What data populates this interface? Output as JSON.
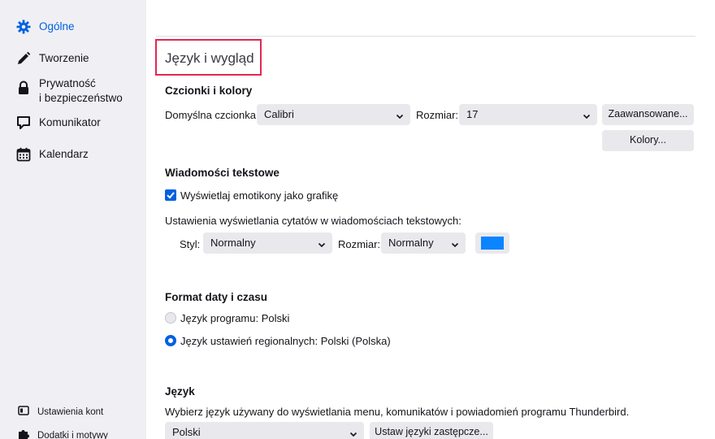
{
  "sidebar": {
    "items": [
      {
        "label": "Ogólne",
        "icon": "gear-icon"
      },
      {
        "label": "Tworzenie",
        "icon": "pencil-icon"
      },
      {
        "label": "Prywatność",
        "label2": "i bezpieczeństwo",
        "icon": "lock-icon"
      },
      {
        "label": "Komunikator",
        "icon": "chat-icon"
      },
      {
        "label": "Kalendarz",
        "icon": "calendar-icon"
      }
    ],
    "bottom": [
      {
        "label": "Ustawienia kont",
        "icon": "account-icon"
      },
      {
        "label": "Dodatki i motywy",
        "icon": "puzzle-icon"
      }
    ],
    "accent": "#0061e0"
  },
  "main": {
    "title": "Język i wygląd",
    "fonts": {
      "heading": "Czcionki i kolory",
      "default_font_label": "Domyślna czcionka:",
      "default_font_value": "Calibri",
      "size_label": "Rozmiar:",
      "size_value": "17",
      "advanced_button": "Zaawansowane...",
      "colors_button": "Kolory..."
    },
    "plain_text": {
      "heading": "Wiadomości tekstowe",
      "emoticons_label": "Wyświetlaj emotikony jako grafikę",
      "emoticons_checked": true,
      "quote_settings_label": "Ustawienia wyświetlania cytatów w wiadomościach tekstowych:",
      "style_label": "Styl:",
      "style_value": "Normalny",
      "size_label": "Rozmiar:",
      "size_value": "Normalny",
      "quote_color": "#0a84ff"
    },
    "datetime": {
      "heading": "Format daty i czasu",
      "option_app": "Język programu: Polski",
      "option_regional": "Język ustawień regionalnych: Polski (Polska)",
      "selected": "regional"
    },
    "language": {
      "heading": "Język",
      "description": "Wybierz język używany do wyświetlania menu, komunikatów i powiadomień programu Thunderbird.",
      "value": "Polski",
      "alternatives_button": "Ustaw języki zastępcze..."
    }
  }
}
